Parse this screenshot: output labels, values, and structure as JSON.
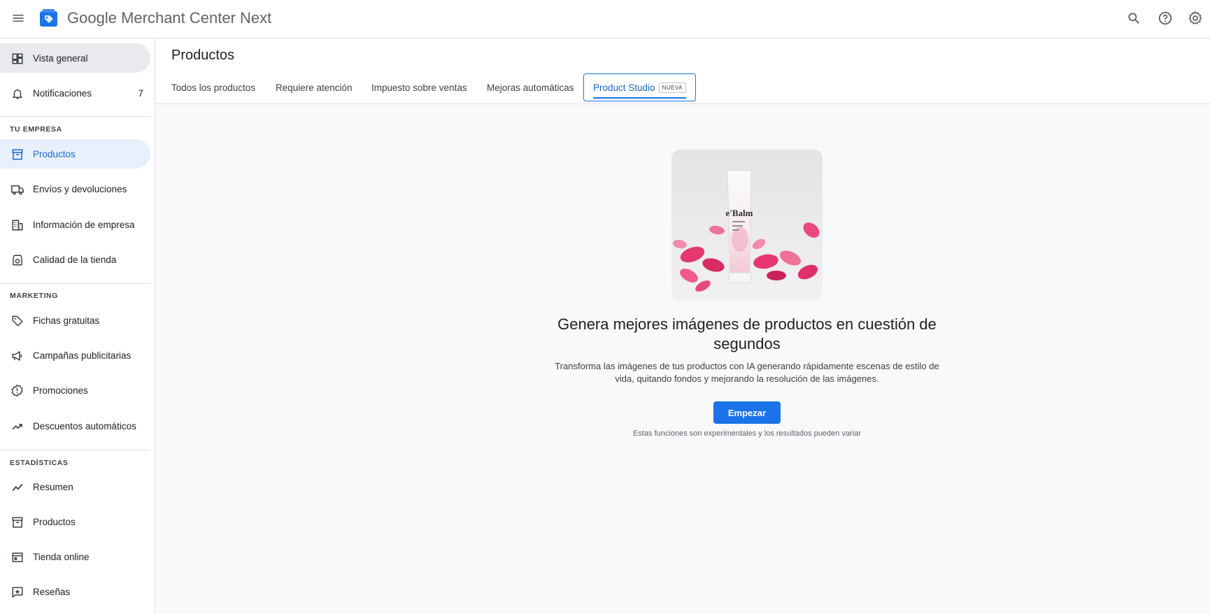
{
  "app": {
    "brand": "Google",
    "product": "Merchant Center Next"
  },
  "topbar": {
    "icons": [
      "menu-icon",
      "search-icon",
      "help-icon",
      "settings-icon"
    ]
  },
  "sidebar": {
    "top_items": [
      {
        "label": "Vista general",
        "icon": "dashboard-icon"
      },
      {
        "label": "Notificaciones",
        "icon": "bell-icon",
        "count": "7"
      }
    ],
    "sections": [
      {
        "header": "TU EMPRESA",
        "items": [
          {
            "label": "Productos",
            "icon": "archive-box-icon"
          },
          {
            "label": "Envíos y devoluciones",
            "icon": "truck-icon"
          },
          {
            "label": "Información de empresa",
            "icon": "building-icon"
          },
          {
            "label": "Calidad de la tienda",
            "icon": "store-quality-icon"
          }
        ]
      },
      {
        "header": "MARKETING",
        "items": [
          {
            "label": "Fichas gratuitas",
            "icon": "tag-icon"
          },
          {
            "label": "Campañas publicitarias",
            "icon": "megaphone-icon"
          },
          {
            "label": "Promociones",
            "icon": "promotion-badge-icon"
          },
          {
            "label": "Descuentos automáticos",
            "icon": "trending-up-icon"
          }
        ]
      },
      {
        "header": "ESTADÍSTICAS",
        "items": [
          {
            "label": "Resumen",
            "icon": "trend-line-icon"
          },
          {
            "label": "Productos",
            "icon": "archive-box-icon"
          },
          {
            "label": "Tienda online",
            "icon": "web-window-icon"
          },
          {
            "label": "Reseñas",
            "icon": "review-star-icon"
          }
        ]
      }
    ]
  },
  "main": {
    "title": "Productos",
    "tabs": [
      {
        "label": "Todos los productos"
      },
      {
        "label": "Requiere atención"
      },
      {
        "label": "Impuesto sobre ventas"
      },
      {
        "label": "Mejoras automáticas"
      },
      {
        "label": "Product Studio",
        "badge": "NUEVA"
      }
    ],
    "hero": {
      "product_text": "e'Balm",
      "headline": "Genera mejores imágenes de productos en cuestión de segundos",
      "description": "Transforma las imágenes de tus productos con IA generando rápidamente escenas de estilo de vida, quitando fondos y mejorando la resolución de las imágenes.",
      "cta_label": "Empezar",
      "note": "Estas funciones son experimentales y los resultados pueden variar"
    }
  },
  "colors": {
    "accent": "#1a73e8",
    "selected_bg": "#e8f0fe",
    "overview_bg": "#e8eaed",
    "main_bg": "#f8f9fa"
  }
}
